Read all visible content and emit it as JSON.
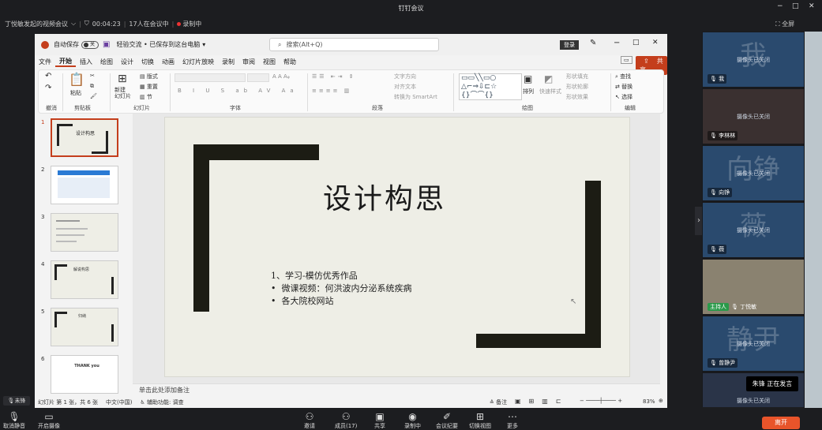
{
  "window": {
    "title": "钉钉会议",
    "fullscreen": "全屏"
  },
  "meeting": {
    "name": "丁悦敏发起的视频会议",
    "timer": "00:04:23",
    "participants": "17人在会议中",
    "recording": "录制中"
  },
  "ppt": {
    "autosave": "自动保存",
    "autosave_state": "关",
    "filename": "轻验交流 • 已保存到这台电脑",
    "search_placeholder": "搜索(Alt+Q)",
    "login": "登录",
    "share": "共享",
    "menu": [
      "文件",
      "开始",
      "插入",
      "绘图",
      "设计",
      "切换",
      "动画",
      "幻灯片放映",
      "录制",
      "审阅",
      "视图",
      "帮助"
    ],
    "ribbon": {
      "undo": "撤消",
      "clipboard": "剪贴板",
      "paste": "粘贴",
      "slides": "幻灯片",
      "new_slide": "新建\n幻灯片",
      "layout": "版式",
      "reset": "重置",
      "section": "节",
      "font": "字体",
      "paragraph": "段落",
      "text_dir": "文字方向",
      "align_text": "对齐文本",
      "smartart": "转换为 SmartArt",
      "drawing": "绘图",
      "arrange": "排列",
      "quick_styles": "快速样式",
      "shape_fill": "形状填充",
      "shape_outline": "形状轮廓",
      "shape_effect": "形状效果",
      "find": "查找",
      "replace": "替换",
      "select": "选择",
      "editing": "编辑"
    },
    "slide_numbers": [
      "1",
      "2",
      "3",
      "4",
      "5",
      "6"
    ],
    "thumb_texts": {
      "t1": "设计构思",
      "t4": "解说构思",
      "t5": "归纳",
      "t6": "THANK you"
    },
    "slide": {
      "title": "设计构思",
      "line1": "1、学习-模仿优秀作品",
      "bullet1": "微课视频：何洪波内分泌系统疾病",
      "bullet2": "各大院校网站"
    },
    "notes": "单击此处添加备注",
    "status": {
      "slide_info": "幻灯片 第 1 张，共 6 张",
      "lang": "中文(中国)",
      "accessibility": "辅助功能: 调查",
      "notes": "备注",
      "zoom": "83%"
    }
  },
  "participants": [
    {
      "big": "我",
      "off": "摄像头已关闭",
      "name": "我"
    },
    {
      "big": "",
      "off": "摄像头已关闭",
      "name": "李林林"
    },
    {
      "big": "向铮",
      "off": "摄像头已关闭",
      "name": "向铮"
    },
    {
      "big": "薇",
      "off": "摄像头已关闭",
      "name": "薇"
    },
    {
      "big": "",
      "off": "",
      "name": "丁悦敏",
      "host": "主持人"
    },
    {
      "big": "静尹",
      "off": "摄像头已关闭",
      "name": "曾静尹"
    },
    {
      "big": "",
      "off": "摄像头已关闭",
      "name": ""
    }
  ],
  "speaking": "朱锋  正在发言",
  "mini_mic": "未锋",
  "bottom": [
    {
      "icon": "mic-icon",
      "label": "取消静音"
    },
    {
      "icon": "camera-icon",
      "label": "开启摄像"
    },
    {
      "icon": "invite-icon",
      "label": "邀请"
    },
    {
      "icon": "members-icon",
      "label": "成员(17)"
    },
    {
      "icon": "share-screen-icon",
      "label": "共享"
    },
    {
      "icon": "record-icon",
      "label": "录制中"
    },
    {
      "icon": "minutes-icon",
      "label": "会议纪要"
    },
    {
      "icon": "layout-icon",
      "label": "切换视图"
    },
    {
      "icon": "more-icon",
      "label": "更多"
    }
  ],
  "leave": "离开",
  "colors": {
    "accent": "#c43e1c",
    "leave": "#e8542a",
    "slide_bg": "#eeeee6",
    "frame": "#1c1c14"
  }
}
